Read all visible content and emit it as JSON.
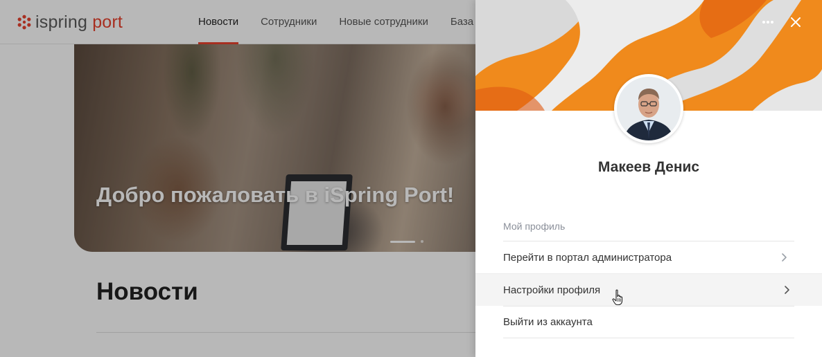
{
  "header": {
    "logo": {
      "word1": "ispring",
      "word2": "port"
    },
    "nav": [
      {
        "label": "Новости",
        "active": true
      },
      {
        "label": "Сотрудники",
        "active": false
      },
      {
        "label": "Новые сотрудники",
        "active": false
      },
      {
        "label": "База знаний",
        "active": false
      }
    ]
  },
  "hero": {
    "title": "Добро пожаловать в iSpring Port!",
    "slides_total": 2,
    "slide_active": 1
  },
  "news_section": {
    "title": "Новости"
  },
  "profile_panel": {
    "user_name": "Макеев Денис",
    "menu_title": "Мой профиль",
    "items": [
      {
        "label": "Перейти в портал администратора"
      },
      {
        "label": "Настройки профиля",
        "hovered": true
      },
      {
        "label": "Выйти из аккаунта"
      }
    ],
    "more_icon": "more-horizontal-icon",
    "close_icon": "close-icon"
  },
  "colors": {
    "brand_accent": "#e8422e",
    "cover_orange": "#f08a1c"
  }
}
